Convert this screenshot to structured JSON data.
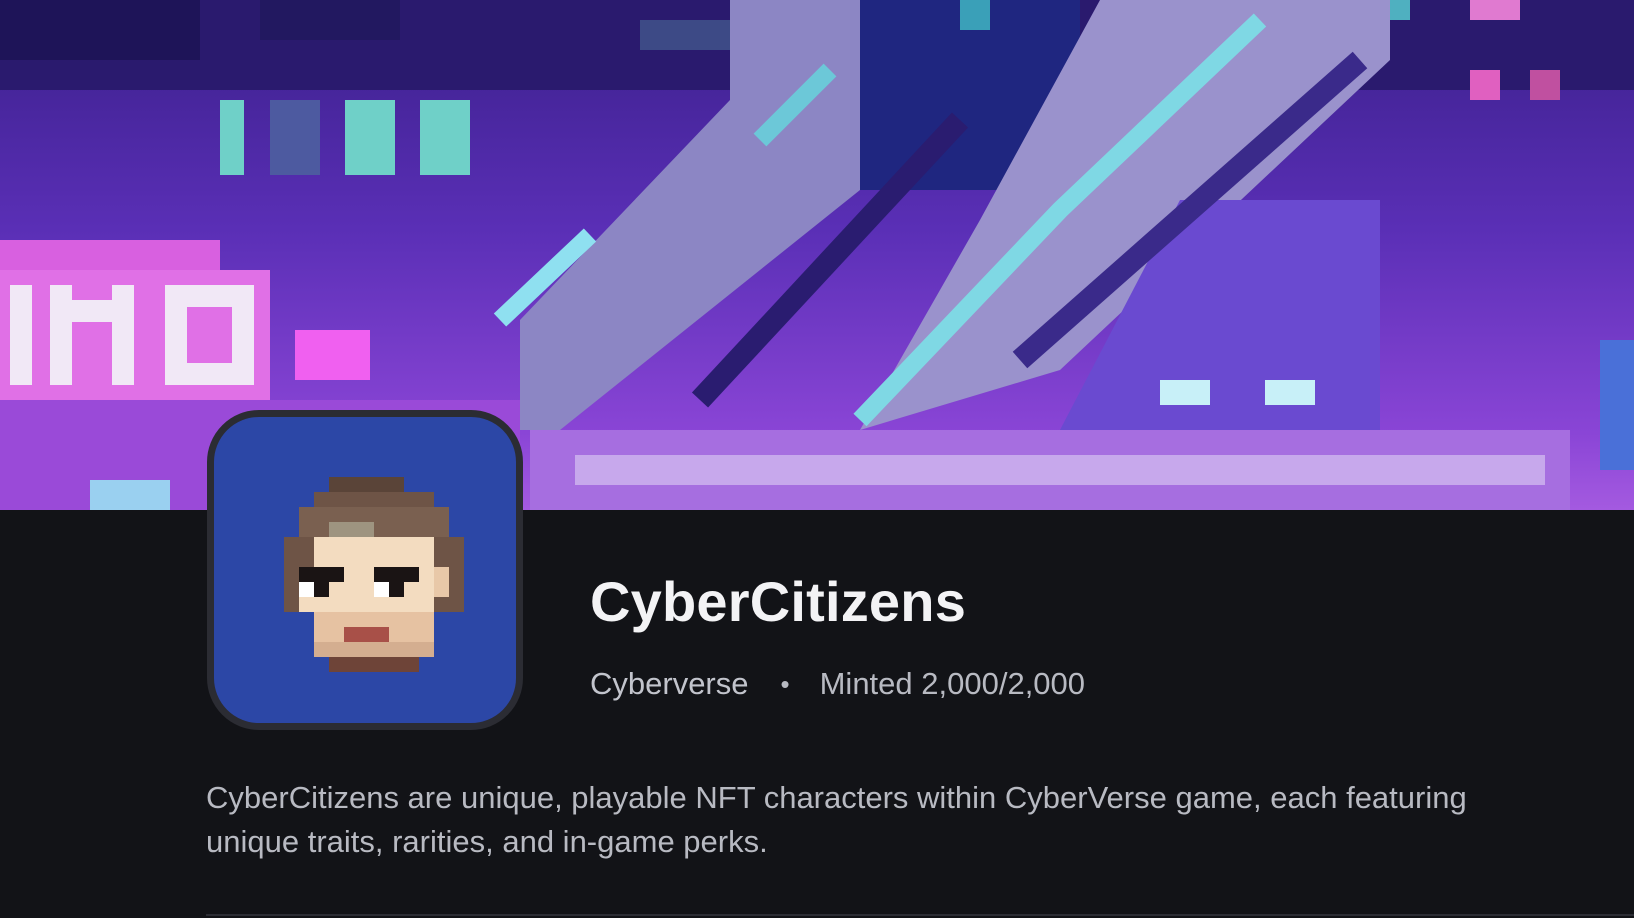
{
  "collection": {
    "name": "CyberCitizens",
    "creator": "Cyberverse",
    "separator": "•",
    "minted": "Minted 2,000/2,000",
    "description": "CyberCitizens are unique, playable NFT characters within CyberVerse game, each featuring unique traits, rarities, and in-game perks."
  },
  "banner": {
    "image": "pixel-art-cyber-city-banner"
  },
  "avatar": {
    "image": "pixel-art-character-portrait",
    "background_color": "#2c47a6"
  },
  "colors": {
    "page_background": "#121317",
    "title_text": "#f3f3f5",
    "secondary_text": "#b8bac2"
  }
}
